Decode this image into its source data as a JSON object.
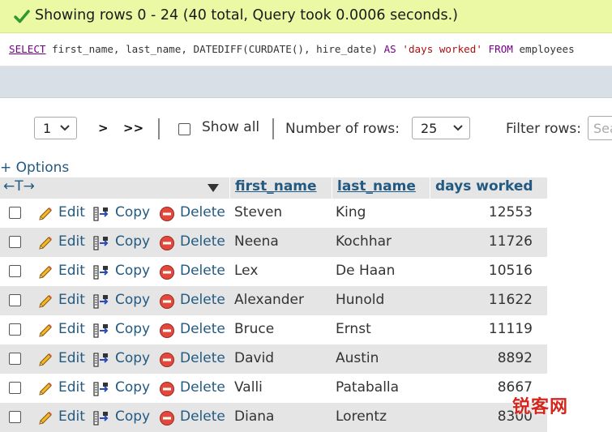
{
  "success": {
    "message": "Showing rows 0 - 24 (40 total, Query took 0.0006 seconds.)"
  },
  "sql": {
    "select_kw": "SELECT",
    "cols": "first_name, last_name,",
    "func": "DATEDIFF",
    "args_open": "(",
    "curdate": "CURDATE",
    "args_mid": "(), hire_date)",
    "as_kw": "AS",
    "alias": "'days worked'",
    "from_kw": "FROM",
    "table": "employees"
  },
  "nav": {
    "page_value": "1",
    "next_label": ">",
    "last_label": ">>",
    "show_all_label": "Show all",
    "rows_label": "Number of rows:",
    "rows_value": "25",
    "filter_label": "Filter rows:",
    "filter_placeholder": "Sea"
  },
  "options_label": "+ Options",
  "table": {
    "resizer": "←T→",
    "columns": [
      "first_name",
      "last_name",
      "days worked"
    ],
    "actions": {
      "edit": "Edit",
      "copy": "Copy",
      "delete": "Delete"
    },
    "rows": [
      {
        "first_name": "Steven",
        "last_name": "King",
        "days": "12553"
      },
      {
        "first_name": "Neena",
        "last_name": "Kochhar",
        "days": "11726"
      },
      {
        "first_name": "Lex",
        "last_name": "De Haan",
        "days": "10516"
      },
      {
        "first_name": "Alexander",
        "last_name": "Hunold",
        "days": "11622"
      },
      {
        "first_name": "Bruce",
        "last_name": "Ernst",
        "days": "11119"
      },
      {
        "first_name": "David",
        "last_name": "Austin",
        "days": "8892"
      },
      {
        "first_name": "Valli",
        "last_name": "Pataballa",
        "days": "8667"
      },
      {
        "first_name": "Diana",
        "last_name": "Lorentz",
        "days": "8300"
      }
    ]
  },
  "watermark": "锐客网",
  "colors": {
    "success_bg": "#ebf8a4",
    "link": "#235a81",
    "row_alt": "#e5e5e5",
    "keyword": "#770088",
    "string": "#aa1111"
  }
}
